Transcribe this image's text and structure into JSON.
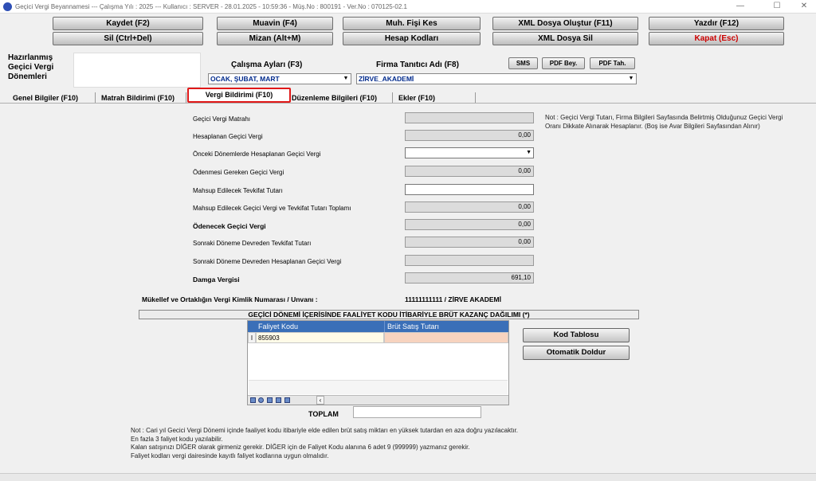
{
  "window": {
    "title": "Geçici Vergi Beyannamesi  ---  Çalışma Yılı : 2025  ---  Kullanıcı : SERVER - 28.01.2025 - 10:59:36 - Müş.No : 800191 - Ver.No : 070125-02.1",
    "min": "—",
    "max": "☐",
    "close": "✕"
  },
  "toolbar": {
    "kaydet": "Kaydet (F2)",
    "muavin": "Muavin (F4)",
    "muh_fisi": "Muh. Fişi Kes",
    "xml_olustur": "XML Dosya Oluştur (F11)",
    "yazdir": "Yazdır (F12)",
    "sil": "Sil (Ctrl+Del)",
    "mizan": "Mizan (Alt+M)",
    "hesap_kodlari": "Hesap Kodları",
    "xml_sil": "XML Dosya Sil",
    "kapat": "Kapat (Esc)"
  },
  "header": {
    "hazirlanmis_label": "Hazırlanmış Geçici Vergi Dönemleri",
    "calisma_aylari_label": "Çalışma Ayları (F3)",
    "calisma_aylari_value": "OCAK, ŞUBAT, MART",
    "firma_label": "Firma Tanıtıcı Adı (F8)",
    "firma_value": "ZİRVE_AKADEMİ",
    "sms": "SMS",
    "pdf_bey": "PDF Bey.",
    "pdf_tah": "PDF Tah."
  },
  "tabs": [
    "Genel Bilgiler (F10)",
    "Matrah Bildirimi (F10)",
    "Vergi Bildirimi (F10)",
    "Düzenleme Bilgileri  (F10)",
    "Ekler (F10)"
  ],
  "form": {
    "fields": [
      {
        "label": "Geçici Vergi Matrahı",
        "value": ""
      },
      {
        "label": "Hesaplanan Geçici Vergi",
        "value": "0,00"
      },
      {
        "label": "Önceki Dönemlerde Hesaplanan Geçici Vergi",
        "value": ""
      },
      {
        "label": "Ödenmesi Gereken Geçici Vergi",
        "value": "0,00"
      },
      {
        "label": "Mahsup Edilecek Tevkifat Tutarı",
        "value": ""
      },
      {
        "label": "Mahsup Edilecek Geçici Vergi ve Tevkifat Tutarı Toplamı",
        "value": "0,00"
      },
      {
        "label": "Ödenecek Geçici Vergi",
        "value": "0,00"
      },
      {
        "label": "Sonraki Döneme Devreden Tevkifat Tutarı",
        "value": "0,00"
      },
      {
        "label": "Sonraki Döneme Devreden Hesaplanan Geçici Vergi",
        "value": ""
      },
      {
        "label": "Damga Vergisi",
        "value": "691,10"
      }
    ],
    "note": "Not : Geçici Vergi Tutarı, Firma Bilgileri Sayfasında Belirtmiş Olduğunuz Geçici Vergi Oranı Dikkate Alınarak Hesaplanır. (Boş ise Avar Bilgileri Sayfasından Alınır)",
    "mukellef_label": "Mükellef ve Ortaklığın Vergi Kimlik Numarası / Unvanı :",
    "mukellef_value": "11111111111 / ZİRVE AKADEMİ"
  },
  "section_title": "GEÇİCİ DÖNEMİ İÇERİSİNDE FAALİYET KODU İTİBARİYLE BRÜT KAZANÇ DAĞILIMI (*)",
  "grid": {
    "columns": [
      "Faliyet Kodu",
      "Brüt Satış Tutarı"
    ],
    "row_marker": "I",
    "rows": [
      {
        "kod": "855903",
        "tutar": ""
      }
    ],
    "scroll_left": "‹"
  },
  "buttons": {
    "kod_tablosu": "Kod Tablosu",
    "otomatik_doldur": "Otomatik Doldur"
  },
  "toplam_label": "TOPLAM",
  "notes": [
    "Not : Cari yıl Gecici Vergi Dönemi içinde faaliyet kodu itibariyle elde edilen brüt satış miktarı en yüksek tutardan en aza doğru yazılacaktır.",
    "En fazla 3 faliyet kodu yazılabilir.",
    "Kalan satışınızı DİĞER olarak girmeniz gerekir. DİĞER için de Faliyet Kodu alanına 6 adet 9 (999999) yazmanız gerekir.",
    "Faliyet kodları vergi dairesinde kayıtlı faliyet kodlarına uygun olmalıdır."
  ],
  "colors": {
    "active_tab_border": "#e01818",
    "grid_header": "#3a6fb8",
    "combo_text": "#002a8c",
    "close_button_text": "#c00000"
  }
}
